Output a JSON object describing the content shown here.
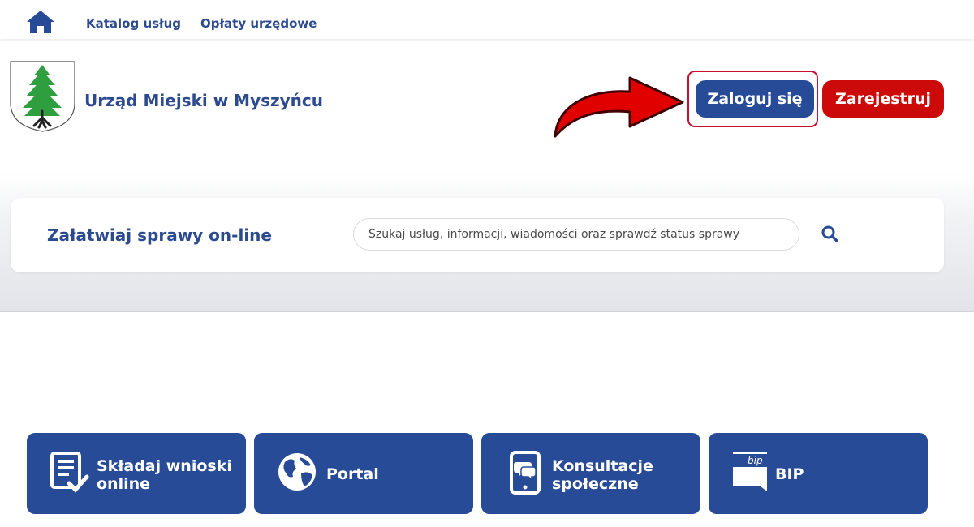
{
  "nav": {
    "home_icon": "home-icon",
    "items": [
      {
        "label": "Katalog usług"
      },
      {
        "label": "Opłaty urzędowe"
      }
    ]
  },
  "header": {
    "org_name": "Urząd Miejski w Myszyńcu",
    "login_label": "Zaloguj się",
    "register_label": "Zarejestruj"
  },
  "search": {
    "title": "Załatwiaj sprawy on-line",
    "placeholder": "Szukaj usług, informacji, wiadomości oraz sprawdź status sprawy",
    "icon": "search-icon"
  },
  "tiles": [
    {
      "label_line1": "Składaj wnioski",
      "label_line2": "online",
      "icon": "document-check-icon"
    },
    {
      "label_line1": "Portal",
      "icon": "globe-icon"
    },
    {
      "label_line1": "Konsultacje",
      "label_line2": "społeczne",
      "icon": "phone-chat-icon"
    },
    {
      "label_line1": "BIP",
      "icon_text": "bip",
      "icon": "bip-icon"
    }
  ],
  "colors": {
    "brand_blue": "#284b98",
    "register_red": "#cc0a0a",
    "highlight_red": "#c8102e",
    "tree_green": "#2e9e3e"
  }
}
